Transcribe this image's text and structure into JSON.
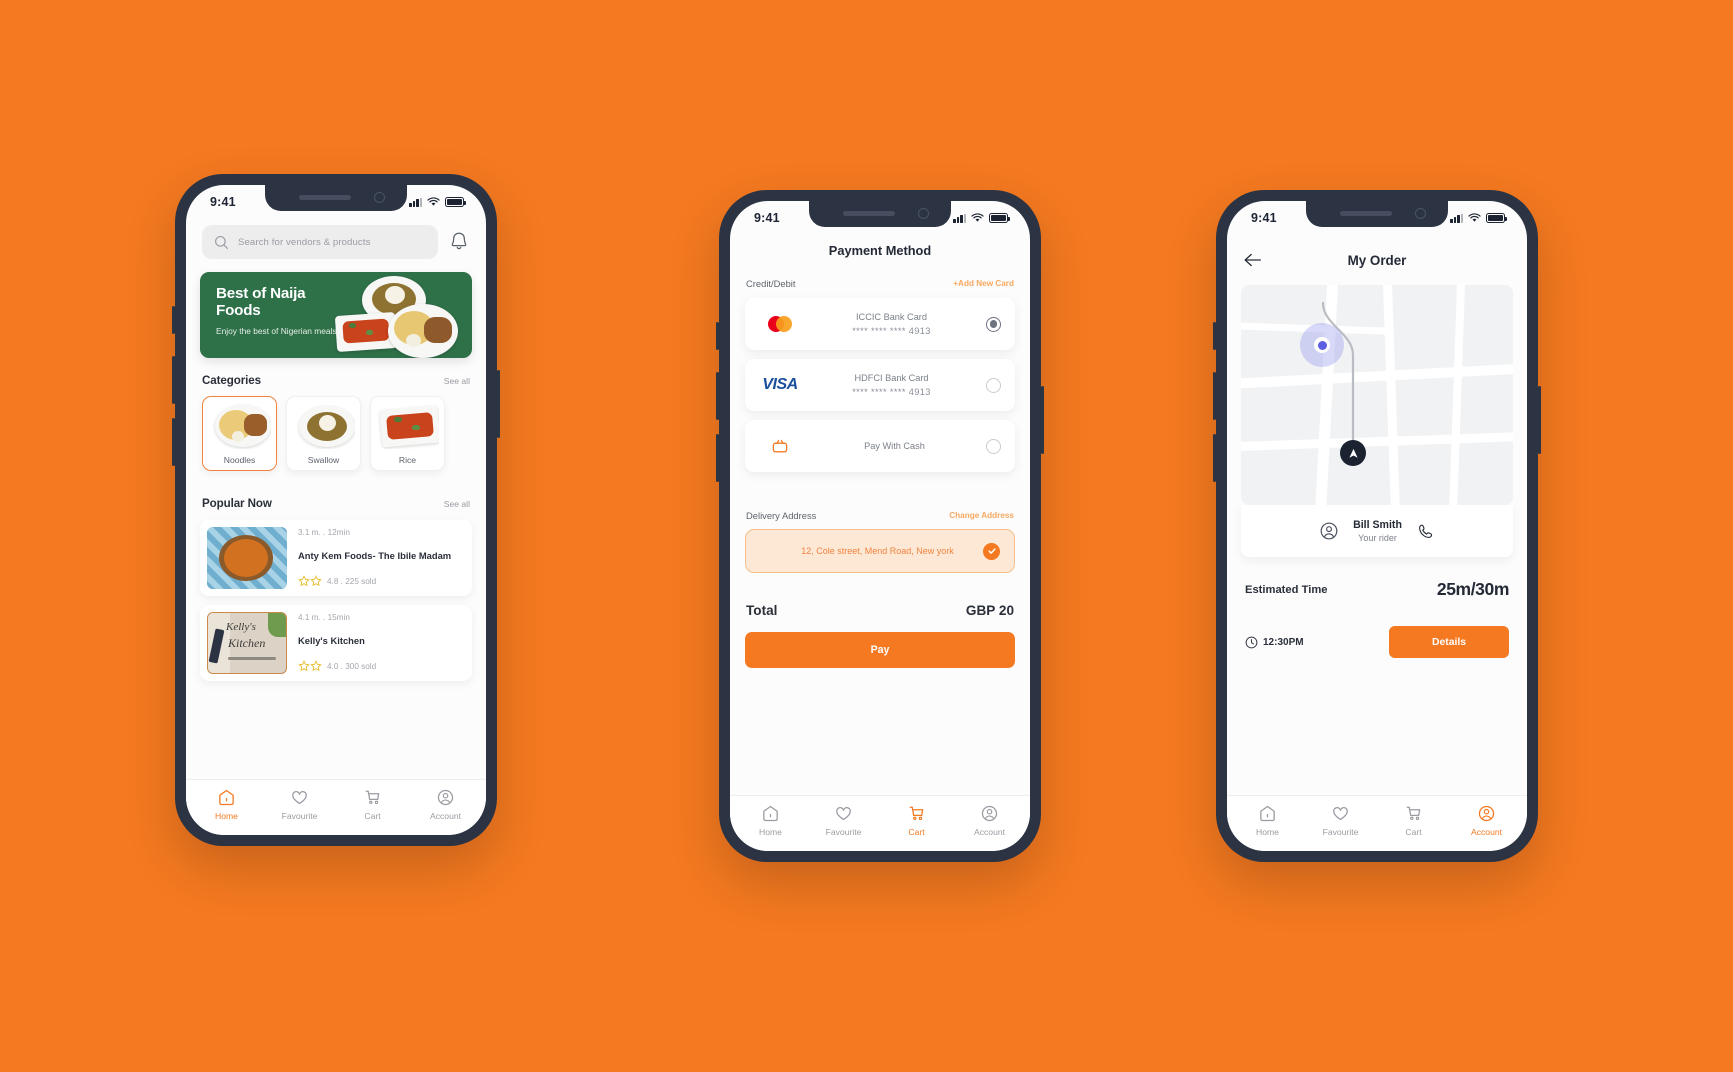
{
  "background_color": "#F47920",
  "accent_color": "#F47920",
  "phones": {
    "home": {
      "status": {
        "time": "9:41",
        "signal_icon": "signal-bars-icon",
        "wifi_icon": "wifi-icon",
        "battery_icon": "battery-icon"
      },
      "search": {
        "placeholder": "Search for vendors & products",
        "icon": "search-icon"
      },
      "notification_icon": "bell-icon",
      "banner": {
        "title": "Best of Naija Foods",
        "subtitle": "Enjoy the best of Nigerian meals",
        "bg_color": "#2E7048"
      },
      "categories_section": {
        "title": "Categories",
        "see_all": "See all",
        "items": [
          {
            "name": "Noodles",
            "selected": true
          },
          {
            "name": "Swallow",
            "selected": false
          },
          {
            "name": "Rice",
            "selected": false
          }
        ]
      },
      "popular_section": {
        "title": "Popular Now",
        "see_all": "See all",
        "items": [
          {
            "meta": "3.1 m. . 12min",
            "name": "Anty Kem Foods- The Ibile Madam",
            "rating": "4.8 . 225 sold"
          },
          {
            "meta": "4.1 m. . 15min",
            "name": "Kelly's Kitchen",
            "rating": "4.0 . 300 sold"
          }
        ]
      },
      "tabs": [
        {
          "label": "Home",
          "icon": "home-icon",
          "active": true
        },
        {
          "label": "Favourite",
          "icon": "heart-icon",
          "active": false
        },
        {
          "label": "Cart",
          "icon": "cart-icon",
          "active": false
        },
        {
          "label": "Account",
          "icon": "account-icon",
          "active": false
        }
      ]
    },
    "payment": {
      "status": {
        "time": "9:41"
      },
      "title": "Payment Method",
      "section_label": "Credit/Debit",
      "add_card_label": "+Add New Card",
      "cards": [
        {
          "brand": "mastercard",
          "name": "ICCIC Bank Card",
          "number": "**** **** **** 4913",
          "selected": true
        },
        {
          "brand": "visa",
          "name": "HDFCI Bank Card",
          "number": "**** **** **** 4913",
          "selected": false
        },
        {
          "brand": "cash",
          "name": "Pay With Cash",
          "number": "",
          "selected": false
        }
      ],
      "delivery": {
        "label": "Delivery Address",
        "change_label": "Change Address",
        "address": "12, Cole street, Mend Road, New york",
        "confirmed_icon": "check-circle-icon"
      },
      "total": {
        "label": "Total",
        "value": "GBP 20"
      },
      "pay_button": "Pay",
      "tabs": [
        {
          "label": "Home",
          "icon": "home-icon",
          "active": false
        },
        {
          "label": "Favourite",
          "icon": "heart-icon",
          "active": false
        },
        {
          "label": "Cart",
          "icon": "cart-icon",
          "active": true
        },
        {
          "label": "Account",
          "icon": "account-icon",
          "active": false
        }
      ]
    },
    "order": {
      "status": {
        "time": "9:41"
      },
      "back_icon": "arrow-left-icon",
      "title": "My Order",
      "map": {
        "user_pin": "user-location-pin",
        "rider_pin": "rider-marker-icon"
      },
      "rider": {
        "name": "Bill Smith",
        "subtitle": "Your rider",
        "avatar_icon": "user-circle-icon",
        "call_icon": "phone-icon"
      },
      "eta": {
        "label": "Estimated Time",
        "value": "25m/30m"
      },
      "time": {
        "icon": "clock-icon",
        "value": "12:30PM"
      },
      "details_button": "Details",
      "tabs": [
        {
          "label": "Home",
          "icon": "home-icon",
          "active": false
        },
        {
          "label": "Favourite",
          "icon": "heart-icon",
          "active": false
        },
        {
          "label": "Cart",
          "icon": "cart-icon",
          "active": false
        },
        {
          "label": "Account",
          "icon": "account-icon",
          "active": true
        }
      ]
    }
  }
}
